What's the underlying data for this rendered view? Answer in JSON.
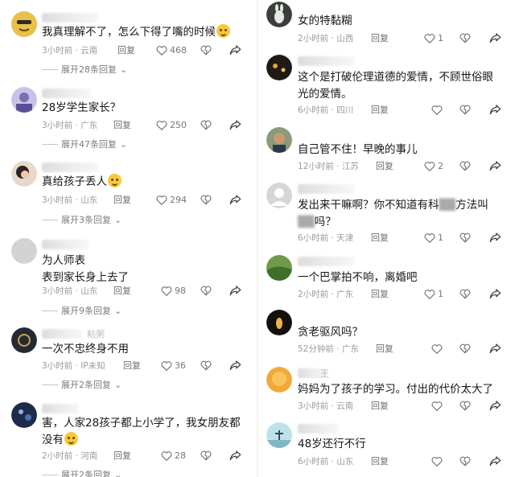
{
  "left": [
    {
      "text": "我真理解不了，怎么下得了嘴的时候",
      "emoji": "laughing-crying-emoji",
      "time": "3小时前 · 云南",
      "reply": "回复",
      "likes": "468",
      "expand": "展开28条回复"
    },
    {
      "text": "28岁学生家长？",
      "time": "3小时前 · 广东",
      "reply": "回复",
      "likes": "250",
      "expand": "展开47条回复"
    },
    {
      "text": "真给孩子丢人",
      "emoji": "sweat-smile-emoji",
      "time": "3小时前 · 山东",
      "reply": "回复",
      "likes": "294",
      "expand": "展开3条回复"
    },
    {
      "text_line1": "为人师表",
      "text_line2": "表到家长身上去了",
      "time": "3小时前 · 山东",
      "reply": "回复",
      "likes": "98",
      "expand": "展开9条回复"
    },
    {
      "username_hint": "粘粥",
      "text": "一次不忠终身不用",
      "time": "3小时前 · IP未知",
      "reply": "回复",
      "likes": "36",
      "expand": "展开2条回复"
    },
    {
      "text_line1": "害，人家28孩子都上小学了，我女朋友都",
      "text_line2": "没有",
      "emoji": "cry-emoji",
      "time": "2小时前 · 河南",
      "reply": "回复",
      "likes": "28",
      "expand": "展开2条回复"
    }
  ],
  "right": [
    {
      "text": "女的特黏糊",
      "time": "2小时前 · 山西",
      "reply": "回复",
      "likes": "1"
    },
    {
      "text_line1": "这个是打破伦理道德的爱情，不顾世俗眼",
      "text_line2": "光的爱情。",
      "time": "6小时前 · 四川",
      "reply": "回复",
      "likes": ""
    },
    {
      "text": "自己管不住！早晚的事儿",
      "time": "12小时前 · 江苏",
      "reply": "回复",
      "likes": "2"
    },
    {
      "text_line1_a": "发出来干嘛啊？你不知道有科",
      "text_line1_b": "方法叫",
      "text_line2": "吗？",
      "time": "6小时前 · 天津",
      "reply": "回复",
      "likes": "1"
    },
    {
      "text": "一个巴掌拍不响，离婚吧",
      "time": "2小时前 · 广东",
      "reply": "回复",
      "likes": "1"
    },
    {
      "text": "贪老驱风吗？",
      "time": "52分钟前 · 广东",
      "reply": "回复",
      "likes": ""
    },
    {
      "username_hint": "王",
      "text": "妈妈为了孩子的学习。付出的代价太大了",
      "time": "3小时前 · 云南",
      "reply": "回复",
      "likes": ""
    },
    {
      "text": "48岁还行不行",
      "time": "6小时前 · 山东",
      "reply": "回复",
      "likes": ""
    }
  ]
}
